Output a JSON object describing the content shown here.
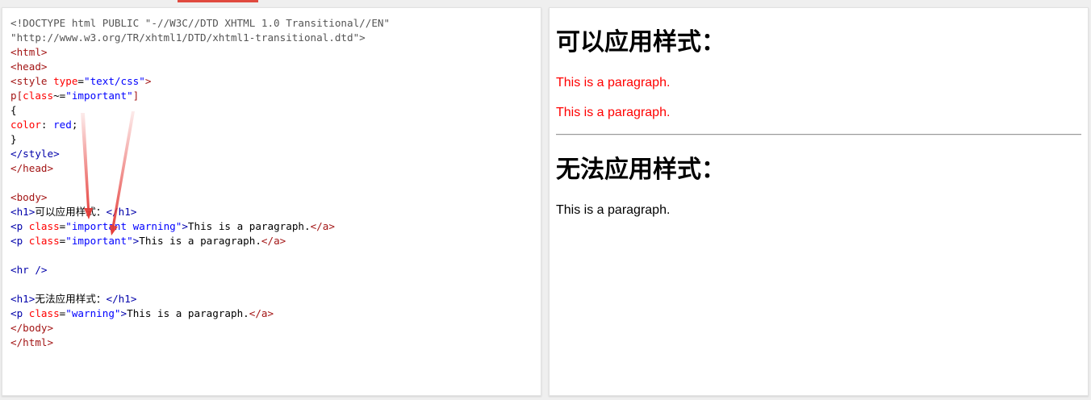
{
  "code_lines": [
    [
      {
        "t": "<!DOCTYPE html PUBLIC \"-//W3C//DTD XHTML 1.0 Transitional//EN\"",
        "c": "doctype"
      }
    ],
    [
      {
        "t": "\"http://www.w3.org/TR/xhtml1/DTD/xhtml1-transitional.dtd\">",
        "c": "doctype"
      }
    ],
    [
      {
        "t": "<html>",
        "c": "tag"
      }
    ],
    [
      {
        "t": "<head>",
        "c": "tag"
      }
    ],
    [
      {
        "t": "<style ",
        "c": "tag"
      },
      {
        "t": "type",
        "c": "attr"
      },
      {
        "t": "=",
        "c": "text"
      },
      {
        "t": "\"text/css\"",
        "c": "val"
      },
      {
        "t": ">",
        "c": "tag"
      }
    ],
    [
      {
        "t": "p[",
        "c": "tag"
      },
      {
        "t": "class",
        "c": "attr"
      },
      {
        "t": "~=",
        "c": "text"
      },
      {
        "t": "\"important\"",
        "c": "val"
      },
      {
        "t": "]",
        "c": "tag"
      }
    ],
    [
      {
        "t": "{",
        "c": "text"
      }
    ],
    [
      {
        "t": "color",
        "c": "prop"
      },
      {
        "t": ": ",
        "c": "text"
      },
      {
        "t": "red",
        "c": "val"
      },
      {
        "t": ";",
        "c": "text"
      }
    ],
    [
      {
        "t": "}",
        "c": "text"
      }
    ],
    [
      {
        "t": "</style>",
        "c": "tagblue"
      }
    ],
    [
      {
        "t": "</head>",
        "c": "tag"
      }
    ],
    [
      {
        "t": "",
        "c": "text"
      }
    ],
    [
      {
        "t": "<body>",
        "c": "tag"
      }
    ],
    [
      {
        "t": "<h1>",
        "c": "tagblue"
      },
      {
        "t": "可以应用样式：",
        "c": "text"
      },
      {
        "t": "</h1>",
        "c": "tagblue"
      }
    ],
    [
      {
        "t": "<p ",
        "c": "tagblue"
      },
      {
        "t": "class",
        "c": "attr"
      },
      {
        "t": "=",
        "c": "text"
      },
      {
        "t": "\"important warning\"",
        "c": "val"
      },
      {
        "t": ">",
        "c": "tagblue"
      },
      {
        "t": "This is a paragraph.",
        "c": "text"
      },
      {
        "t": "</a>",
        "c": "tag"
      }
    ],
    [
      {
        "t": "<p ",
        "c": "tagblue"
      },
      {
        "t": "class",
        "c": "attr"
      },
      {
        "t": "=",
        "c": "text"
      },
      {
        "t": "\"important\"",
        "c": "val"
      },
      {
        "t": ">",
        "c": "tagblue"
      },
      {
        "t": "This is a paragraph.",
        "c": "text"
      },
      {
        "t": "</a>",
        "c": "tag"
      }
    ],
    [
      {
        "t": "",
        "c": "text"
      }
    ],
    [
      {
        "t": "<hr />",
        "c": "tagblue"
      }
    ],
    [
      {
        "t": "",
        "c": "text"
      }
    ],
    [
      {
        "t": "<h1>",
        "c": "tagblue"
      },
      {
        "t": "无法应用样式：",
        "c": "text"
      },
      {
        "t": "</h1>",
        "c": "tagblue"
      }
    ],
    [
      {
        "t": "<p ",
        "c": "tagblue"
      },
      {
        "t": "class",
        "c": "attr"
      },
      {
        "t": "=",
        "c": "text"
      },
      {
        "t": "\"warning\"",
        "c": "val"
      },
      {
        "t": ">",
        "c": "tagblue"
      },
      {
        "t": "This is a paragraph.",
        "c": "text"
      },
      {
        "t": "</a>",
        "c": "tag"
      }
    ],
    [
      {
        "t": "</body>",
        "c": "tag"
      }
    ],
    [
      {
        "t": "</html>",
        "c": "tag"
      }
    ]
  ],
  "colors": {
    "doctype": "#555555",
    "tag": "#a31515",
    "tagblue": "#0000aa",
    "attr": "#ff0000",
    "val": "#0000ff",
    "prop": "#ff0000",
    "text": "#000000",
    "annotation_arrow": "#e53935",
    "applied_red": "#ff0000"
  },
  "result": {
    "heading1": "可以应用样式：",
    "p1": "This is a paragraph.",
    "p2": "This is a paragraph.",
    "heading2": "无法应用样式：",
    "p3": "This is a paragraph."
  }
}
